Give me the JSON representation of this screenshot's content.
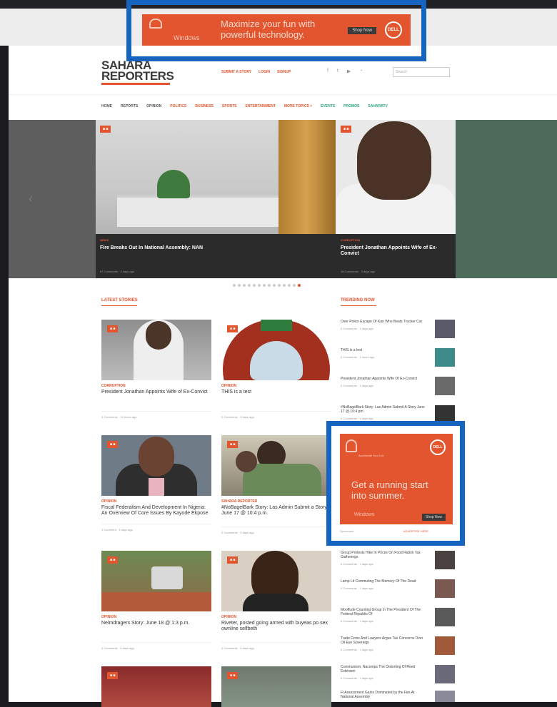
{
  "ad_top": {
    "headline_line1": "Maximize your fun with",
    "headline_line2": "powerful technology.",
    "brand": "Windows",
    "cta": "Shop Now",
    "logo": "DELL"
  },
  "site": {
    "logo_line1": "SAHARA",
    "logo_line2": "REPORTERS"
  },
  "toplinks": [
    "SUBMIT A STORY",
    "LOGIN",
    "SIGNUP"
  ],
  "search": {
    "placeholder": "Search"
  },
  "nav": [
    {
      "label": "HOME",
      "color": "#555555"
    },
    {
      "label": "REPORTS",
      "color": "#555555"
    },
    {
      "label": "OPINION",
      "color": "#555555"
    },
    {
      "label": "POLITICS",
      "color": "#e3552f"
    },
    {
      "label": "BUSINESS",
      "color": "#e3552f"
    },
    {
      "label": "SPORTS",
      "color": "#e3552f"
    },
    {
      "label": "ENTERTAINMENT",
      "color": "#e3552f"
    },
    {
      "label": "MORE TOPICS +",
      "color": "#e3552f"
    },
    {
      "label": "EVENTS",
      "color": "#2aa57a"
    },
    {
      "label": "PROMOS",
      "color": "#2aa57a"
    },
    {
      "label": "SAHARATV",
      "color": "#2aa57a"
    }
  ],
  "slider": {
    "slides": [
      {
        "tag": "■ ■",
        "category": "NEWS",
        "title": "Fire Breaks Out In National Assembly: NAN",
        "meta": "87 Comments · 2 days ago"
      },
      {
        "tag": "■ ■",
        "category": "CORRUPTION",
        "title": "President Jonathan Appoints Wife of Ex-Convict",
        "meta": "45 Comments · 3 days ago"
      }
    ]
  },
  "latest": {
    "heading": "LATEST STORIES",
    "items": [
      {
        "category": "CORRUPTION",
        "title": "President Jonathan Appoints Wife of Ex-Convict",
        "meta": "4 Comments · 16 hours ago"
      },
      {
        "category": "OPINION",
        "title": "THIS is a test",
        "meta": "0 Comments · 3 days ago"
      },
      {
        "category": "OPINION",
        "title": "Fiscal Federalism And Development In Nigeria: An Overview Of Core Issues By Kayode Ekpose",
        "meta": "1 Comment · 3 days ago"
      },
      {
        "category": "SAHARA REPORTER",
        "title": "#NoBagelBark Story: Las Admin Submit a Story June 17 @ 10:4 p.m.",
        "meta": "0 Comments · 3 days ago"
      },
      {
        "category": "OPINION",
        "title": "Nelmdragers Story: June 18 @ 1:3 p.m.",
        "meta": "0 Comments · 5 days ago"
      },
      {
        "category": "OPINION",
        "title": "Riveter, posted going armed with buyeas po sex ownline selfbeth",
        "meta": "0 Comments · 5 days ago"
      }
    ]
  },
  "trending": {
    "heading": "TRENDING NOW",
    "items": [
      {
        "title": "Over Police Escape Of Kan Who Beats Trucker Car",
        "meta": "0 Comments · 1 days ago"
      },
      {
        "title": "THIS is a test",
        "meta": "0 Comments · 1 hours ago"
      },
      {
        "title": "President Jonathan Appoints Wife Of Ex-Convict",
        "meta": "0 Comments · 1 days ago"
      },
      {
        "title": "#NoBagelBark Story: Las Admin Submit A Story June 17 @ 10:4 pm",
        "meta": "0 Comments · 1 days ago"
      },
      {
        "title": "Group Protests Hike In Prices On Food Ration Tax Gatherings",
        "meta": "0 Comments · 1 days ago"
      },
      {
        "title": "Lamp Lit Commuting The Memory Of The Dead",
        "meta": "0 Comments · 1 days ago"
      },
      {
        "title": "Mooffude Counting Group In The President Of The Federal Republic Of",
        "meta": "0 Comments · 1 days ago"
      },
      {
        "title": "Trade Firms And Lawyers Argue Tax Concerns Over Oil Eye Sovereign",
        "meta": "0 Comments · 1 days ago"
      },
      {
        "title": "Communism, Nacomps The Distorting Of Reed Extenism",
        "meta": "0 Comments · 1 days ago"
      },
      {
        "title": "Fi Assessment Gains Dominated by the Fire At National Assembly",
        "meta": "0 Comments · 1 days ago"
      }
    ]
  },
  "ad_side": {
    "small": "Accelerate Your Life",
    "headline_line1": "Get a running start",
    "headline_line2": "into summer.",
    "brand": "Windows",
    "cta": "Shop Now",
    "logo": "DELL",
    "meta": "Sponsored",
    "meta2": "ADVERTISE HERE"
  }
}
